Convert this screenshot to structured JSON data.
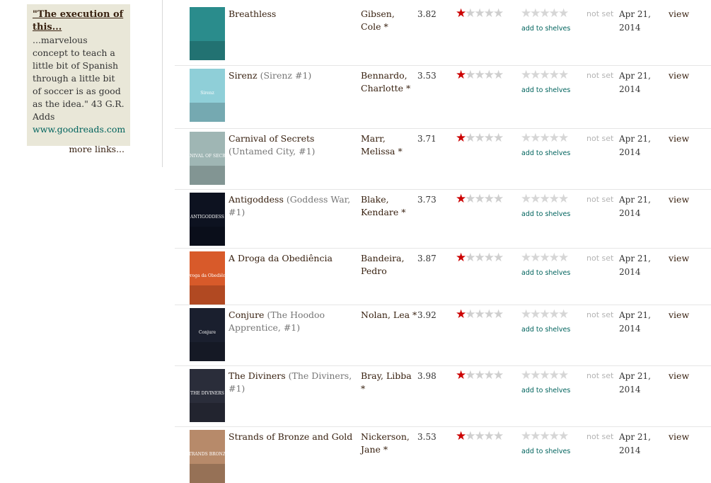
{
  "sidebar": {
    "quote_title": "\"The execution of this...",
    "quote_text": "...marvelous concept to teach a little bit of Spanish through a little bit of soccer is as good as the idea.\" 43 G.R. Adds",
    "quote_source": "www.goodreads.com",
    "more_links": "more links..."
  },
  "books": [
    {
      "title": "Breathless",
      "series": "",
      "author": "Gibsen, Cole",
      "author_mark": "*",
      "avg_rating": "3.82",
      "shelves": "add to shelves",
      "date_read": "not set",
      "date_added": "Apr 21, 2014",
      "view": "view"
    },
    {
      "title": "Sirenz",
      "series": "(Sirenz #1)",
      "author": "Bennardo, Charlotte",
      "author_mark": "*",
      "avg_rating": "3.53",
      "shelves": "add to shelves",
      "date_read": "not set",
      "date_added": "Apr 21, 2014",
      "view": "view"
    },
    {
      "title": "Carnival of Secrets",
      "series": "(Untamed City, #1)",
      "author": "Marr, Melissa",
      "author_mark": "*",
      "avg_rating": "3.71",
      "shelves": "add to shelves",
      "date_read": "not set",
      "date_added": "Apr 21, 2014",
      "view": "view"
    },
    {
      "title": "Antigoddess",
      "series": "(Goddess War, #1)",
      "author": "Blake, Kendare",
      "author_mark": "*",
      "avg_rating": "3.73",
      "shelves": "add to shelves",
      "date_read": "not set",
      "date_added": "Apr 21, 2014",
      "view": "view"
    },
    {
      "title": "A Droga da Obediência",
      "series": "",
      "author": "Bandeira, Pedro",
      "author_mark": "",
      "avg_rating": "3.87",
      "shelves": "add to shelves",
      "date_read": "not set",
      "date_added": "Apr 21, 2014",
      "view": "view"
    },
    {
      "title": "Conjure",
      "series": "(The Hoodoo Apprentice, #1)",
      "author": "Nolan, Lea",
      "author_mark": "*",
      "avg_rating": "3.92",
      "shelves": "add to shelves",
      "date_read": "not set",
      "date_added": "Apr 21, 2014",
      "view": "view"
    },
    {
      "title": "The Diviners",
      "series": "(The Diviners, #1)",
      "author": "Bray, Libba",
      "author_mark": "*",
      "avg_rating": "3.98",
      "shelves": "add to shelves",
      "date_read": "not set",
      "date_added": "Apr 21, 2014",
      "view": "view"
    },
    {
      "title": "Strands of Bronze and Gold",
      "series": "",
      "author": "Nickerson, Jane",
      "author_mark": "*",
      "avg_rating": "3.53",
      "shelves": "add to shelves",
      "date_read": "not set",
      "date_added": "Apr 21, 2014",
      "view": "view"
    }
  ],
  "cover_colors": [
    "#2a8c8c",
    "#8fcfd8",
    "#9fb6b4",
    "#0d1220",
    "#d85a2a",
    "#1a1f2e",
    "#2a2d3a",
    "#b78a6a"
  ],
  "cover_texts": [
    "",
    "Sirenz",
    "CARNIVAL OF SECRETS",
    "ANTIGODDESS",
    "A Droga da Obediência",
    "Conjure",
    "THE DIVINERS",
    "STRANDS BRONZE"
  ],
  "rating_stars_filled": 1,
  "rating_stars_total": 5,
  "colors": {
    "star_on": "#cc0000",
    "star_off": "#cfcfcf",
    "link": "#00635d"
  }
}
